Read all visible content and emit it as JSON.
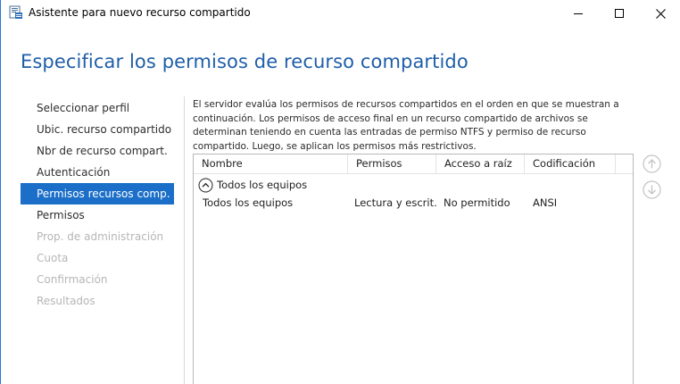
{
  "window": {
    "title": "Asistente para nuevo recurso compartido"
  },
  "page": {
    "heading": "Especificar los permisos de recurso compartido"
  },
  "nav": {
    "items": [
      {
        "label": "Seleccionar perfil",
        "state": "normal"
      },
      {
        "label": "Ubic. recurso compartido",
        "state": "normal"
      },
      {
        "label": "Nbr de recurso compart.",
        "state": "normal"
      },
      {
        "label": "Autenticación",
        "state": "normal"
      },
      {
        "label": "Permisos recursos comp.",
        "state": "active"
      },
      {
        "label": "Permisos",
        "state": "normal"
      },
      {
        "label": "Prop. de administración",
        "state": "disabled"
      },
      {
        "label": "Cuota",
        "state": "disabled"
      },
      {
        "label": "Confirmación",
        "state": "disabled"
      },
      {
        "label": "Resultados",
        "state": "disabled"
      }
    ]
  },
  "description": "El servidor evalúa los permisos de recursos compartidos en el orden en que se muestran a continuación. Los permisos de acceso final en un recurso compartido de archivos se determinan teniendo en cuenta las entradas de permiso NTFS y permiso de recurso compartido. Luego, se aplican los permisos más restrictivos.",
  "grid": {
    "columns": [
      "Nombre",
      "Permisos",
      "Acceso a raíz",
      "Codificación"
    ],
    "group": {
      "label": "Todos los equipos",
      "icon": "collapse-up-icon"
    },
    "rows": [
      {
        "nombre": "Todos los equipos",
        "permisos": "Lectura y escrit…",
        "acceso": "No permitido",
        "codificacion": "ANSI"
      }
    ]
  },
  "side_buttons": {
    "up_icon": "arrow-up-icon",
    "down_icon": "arrow-down-icon"
  },
  "colors": {
    "accent": "#1b6fc8",
    "heading": "#1e5ea8",
    "disabled_text": "#b6b6b6",
    "frame": "#2b78d4"
  }
}
